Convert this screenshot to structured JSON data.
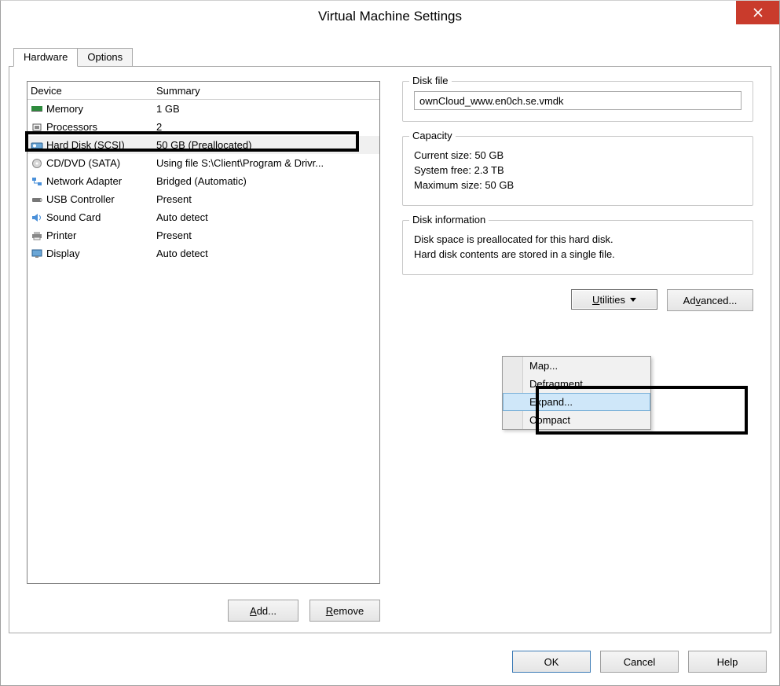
{
  "title": "Virtual Machine Settings",
  "tabs": {
    "hardware": "Hardware",
    "options": "Options"
  },
  "columns": {
    "device": "Device",
    "summary": "Summary"
  },
  "devices": [
    {
      "name": "Memory",
      "summary": "1 GB"
    },
    {
      "name": "Processors",
      "summary": "2"
    },
    {
      "name": "Hard Disk (SCSI)",
      "summary": "50 GB (Preallocated)"
    },
    {
      "name": "CD/DVD (SATA)",
      "summary": "Using file S:\\Client\\Program & Drivr..."
    },
    {
      "name": "Network Adapter",
      "summary": "Bridged (Automatic)"
    },
    {
      "name": "USB Controller",
      "summary": "Present"
    },
    {
      "name": "Sound Card",
      "summary": "Auto detect"
    },
    {
      "name": "Printer",
      "summary": "Present"
    },
    {
      "name": "Display",
      "summary": "Auto detect"
    }
  ],
  "left_buttons": {
    "add": "Add...",
    "remove": "Remove"
  },
  "disk_file": {
    "title": "Disk file",
    "value": "ownCloud_www.en0ch.se.vmdk"
  },
  "capacity": {
    "title": "Capacity",
    "current_label": "Current size:",
    "current_value": "50 GB",
    "free_label": "System free:",
    "free_value": "2.3 TB",
    "max_label": "Maximum size:",
    "max_value": "50 GB"
  },
  "disk_info": {
    "title": "Disk information",
    "line1": "Disk space is preallocated for this hard disk.",
    "line2": "Hard disk contents are stored in a single file."
  },
  "right_buttons": {
    "utilities": "Utilities",
    "advanced": "Advanced..."
  },
  "menu": {
    "map": "Map...",
    "defrag": "Defragment",
    "expand": "Expand...",
    "compact": "Compact"
  },
  "footer": {
    "ok": "OK",
    "cancel": "Cancel",
    "help": "Help"
  }
}
